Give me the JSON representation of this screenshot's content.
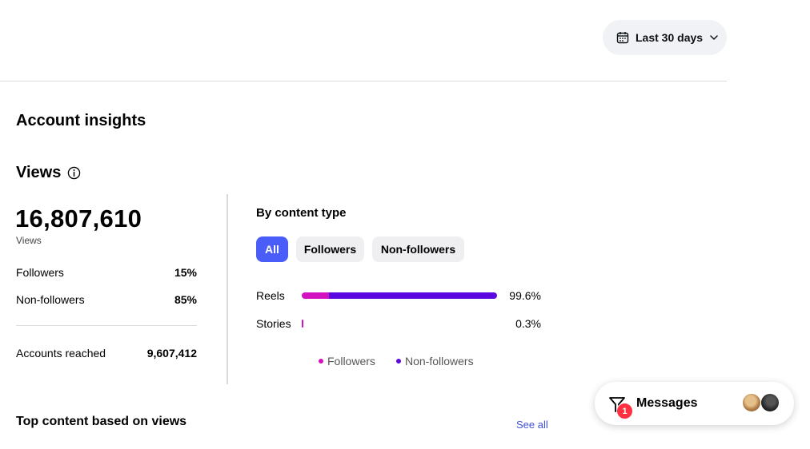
{
  "header": {
    "date_range": "Last 30 days",
    "calendar_icon": "calendar-icon",
    "dropdown_icon": "chevron-down-icon"
  },
  "page": {
    "title": "Account insights"
  },
  "views": {
    "title": "Views",
    "info_icon": "info-icon",
    "total": "16,807,610",
    "total_caption": "Views",
    "rows": [
      {
        "label": "Followers",
        "value": "15%"
      },
      {
        "label": "Non-followers",
        "value": "85%"
      }
    ],
    "accounts_reached_label": "Accounts reached",
    "accounts_reached_value": "9,607,412"
  },
  "content_type": {
    "title": "By content type",
    "tabs": [
      {
        "label": "All",
        "selected": true
      },
      {
        "label": "Followers",
        "selected": false
      },
      {
        "label": "Non-followers",
        "selected": false
      }
    ],
    "bars": [
      {
        "label": "Reels",
        "percent_text": "99.6%",
        "share_of_max": 1.0,
        "followers_fraction": 0.14,
        "nonfollowers_fraction": 0.86
      },
      {
        "label": "Stories",
        "percent_text": "0.3%",
        "share_of_max": 0.005,
        "followers_fraction": 1.0,
        "nonfollowers_fraction": 0.0
      }
    ],
    "legend": [
      {
        "label": "Followers",
        "color": "#d211c1"
      },
      {
        "label": "Non-followers",
        "color": "#5b08e0"
      }
    ]
  },
  "top_content": {
    "title": "Top content based on views",
    "see_all": "See all"
  },
  "messages": {
    "label": "Messages",
    "badge_count": "1",
    "icon": "messenger-filter-icon"
  },
  "colors": {
    "accent": "#4a5df9",
    "link": "#4150d8",
    "badge": "#ff3040"
  }
}
